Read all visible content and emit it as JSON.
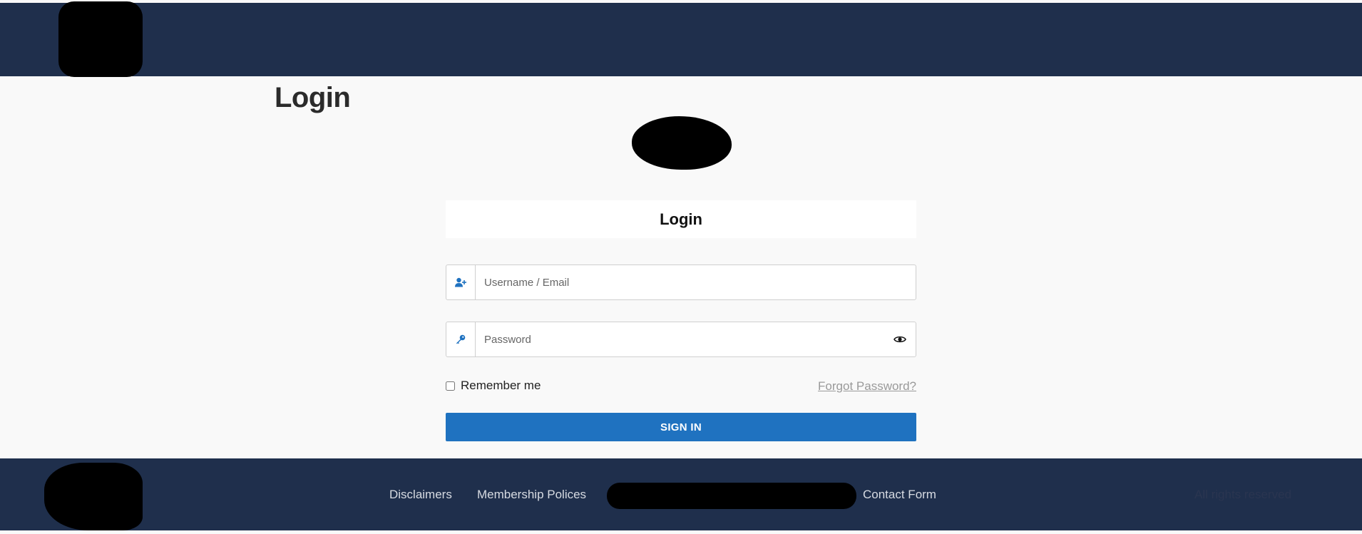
{
  "page": {
    "title": "Login"
  },
  "login_card": {
    "header": "Login",
    "username": {
      "placeholder": "Username / Email",
      "value": ""
    },
    "password": {
      "placeholder": "Password",
      "value": ""
    },
    "remember_label": "Remember me",
    "forgot_label": "Forgot Password?",
    "signin_label": "SIGN IN"
  },
  "footer": {
    "links": [
      "Disclaimers",
      "Membership Polices",
      "Contact Form"
    ],
    "rights_text": "All rights reserved"
  },
  "colors": {
    "header_bg": "#1f2f4c",
    "accent": "#1f72c0",
    "page_bg": "#f9f9f9"
  },
  "icons": {
    "username_addon": "user-plus-icon",
    "password_addon": "key-icon",
    "password_toggle": "eye-icon"
  }
}
